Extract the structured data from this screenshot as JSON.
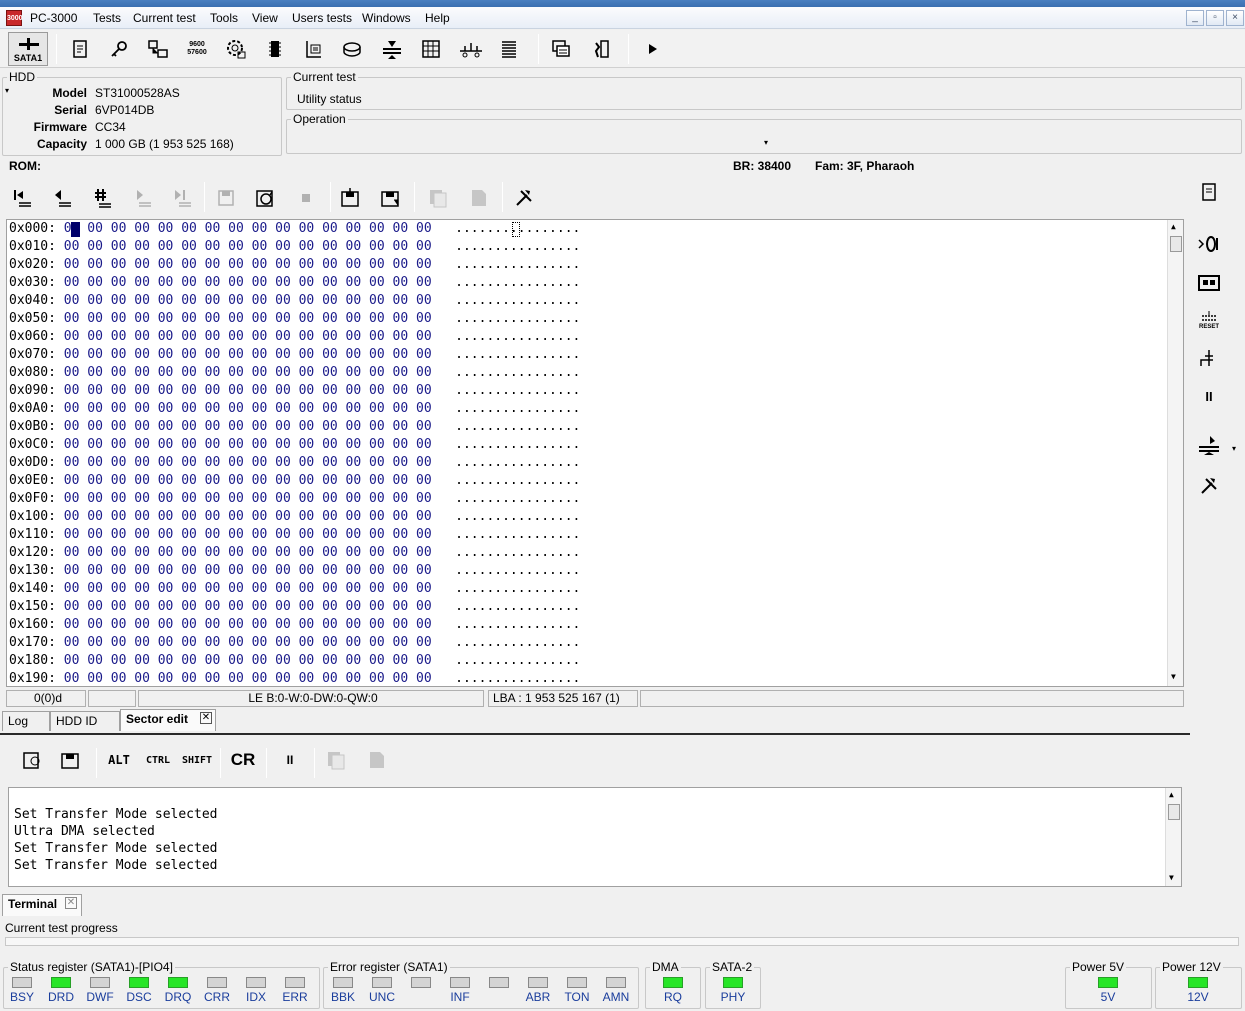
{
  "app": {
    "title": "PC-3000"
  },
  "menu": [
    "Tests",
    "Current test",
    "Tools",
    "View",
    "Users tests",
    "Windows",
    "Help"
  ],
  "window_controls": {
    "minimize": "_",
    "restore": "▫",
    "close": "×"
  },
  "toolbar": {
    "sata_label": "SATA1",
    "baud_icon_text": "9600\n57600",
    "icons": [
      "script-icon",
      "key-icon",
      "drive-connect-icon",
      "baud-rate-icon",
      "gear-disk-icon",
      "chip-icon",
      "hdd-id-icon",
      "disk-drive-icon",
      "heads-icon",
      "table-icon",
      "network-icon",
      "list-icon",
      "copy-windows-icon",
      "exit-icon",
      "play-icon"
    ]
  },
  "hdd": {
    "legend": "HDD",
    "model_label": "Model",
    "model": "ST31000528AS",
    "serial_label": "Serial",
    "serial": "6VP014DB",
    "firmware_label": "Firmware",
    "firmware": "CC34",
    "capacity_label": "Capacity",
    "capacity": "1 000 GB (1 953 525 168)"
  },
  "current_test": {
    "legend": "Current test",
    "status": "Utility status"
  },
  "operation": {
    "legend": "Operation",
    "value": ""
  },
  "rom": {
    "label": "ROM:",
    "br": "BR: 38400",
    "fam": "Fam: 3F, Pharaoh"
  },
  "hex": {
    "rows": [
      "0x000:",
      "0x010:",
      "0x020:",
      "0x030:",
      "0x040:",
      "0x050:",
      "0x060:",
      "0x070:",
      "0x080:",
      "0x090:",
      "0x0A0:",
      "0x0B0:",
      "0x0C0:",
      "0x0D0:",
      "0x0E0:",
      "0x0F0:",
      "0x100:",
      "0x110:",
      "0x120:",
      "0x130:",
      "0x140:",
      "0x150:",
      "0x160:",
      "0x170:",
      "0x180:",
      "0x190:"
    ],
    "bytes": "00 00 00 00 00 00 00 00 00 00 00 00 00 00 00 00",
    "ascii": "................"
  },
  "status": {
    "pos": "0(0)d",
    "blank": "",
    "le": "LE B:0-W:0-DW:0-QW:0",
    "lba": "LBA : 1 953 525 167 (1)"
  },
  "tabs": [
    {
      "label": "Log"
    },
    {
      "label": "HDD ID"
    },
    {
      "label": "Sector edit",
      "active": true,
      "closable": true
    }
  ],
  "terminal": {
    "toolbar": {
      "alt": "ALT",
      "ctrl": "CTRL",
      "shift": "SHIFT",
      "cr": "CR",
      "pause": "II"
    },
    "lines": [
      "Set Transfer Mode selected",
      "Ultra DMA selected",
      "Set Transfer Mode selected",
      "Set Transfer Mode selected"
    ],
    "tab": "Terminal"
  },
  "progress": {
    "label": "Current test progress",
    "value": 0
  },
  "status_register": {
    "legend": "Status register (SATA1)-[PIO4]",
    "bits": [
      {
        "name": "BSY",
        "on": false
      },
      {
        "name": "DRD",
        "on": true
      },
      {
        "name": "DWF",
        "on": false
      },
      {
        "name": "DSC",
        "on": true
      },
      {
        "name": "DRQ",
        "on": true
      },
      {
        "name": "CRR",
        "on": false
      },
      {
        "name": "IDX",
        "on": false
      },
      {
        "name": "ERR",
        "on": false
      }
    ]
  },
  "error_register": {
    "legend": "Error register (SATA1)",
    "bits": [
      {
        "name": "BBK",
        "on": false
      },
      {
        "name": "UNC",
        "on": false
      },
      {
        "name": "",
        "on": false
      },
      {
        "name": "INF",
        "on": false
      },
      {
        "name": "",
        "on": false
      },
      {
        "name": "ABR",
        "on": false
      },
      {
        "name": "TON",
        "on": false
      },
      {
        "name": "AMN",
        "on": false
      }
    ]
  },
  "dma": {
    "legend": "DMA",
    "bit": "RQ",
    "on": true
  },
  "sata2": {
    "legend": "SATA-2",
    "bit": "PHY",
    "on": true
  },
  "power5": {
    "legend": "Power 5V",
    "bit": "5V",
    "on": true
  },
  "power12": {
    "legend": "Power 12V",
    "bit": "12V",
    "on": true
  },
  "colors": {
    "led_on": "#27e527",
    "led_off": "#d4d4d4",
    "hex_bytes": "#1a1a8a",
    "label_blue": "#1a3d9c"
  }
}
